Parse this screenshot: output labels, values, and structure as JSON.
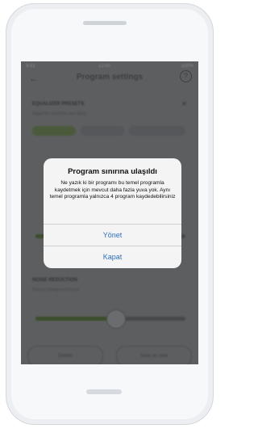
{
  "background_screen": {
    "status_left": "9:41",
    "status_center": "12:00",
    "status_right": "100%",
    "nav_title": "Program settings",
    "back_icon": "back-arrow-icon",
    "help_icon": "question-icon",
    "section1_title": "EQUALIZER PRESETS",
    "section1_sub": "Adjust the sound to your liking.",
    "section2_title": "NOISE REDUCTION",
    "section2_sub": "Reduce background noise.",
    "button_left": "Delete",
    "button_right": "Save as new",
    "colors": {
      "overlay": "#5c5e5f",
      "accent": "#3c4e2c"
    }
  },
  "dialog": {
    "title": "Program sınırına ulaşıldı",
    "message": "Ne yazık ki bir programı bu temel programla kaydetmek için mevcut daha fazla yuva yok. Aynı temel programla yalnızca 4 program kaydedebilirsiniz",
    "manage_label": "Yönet",
    "close_label": "Kapat",
    "colors": {
      "background": "#f4f4f5",
      "button_text": "#2e6fc6"
    }
  }
}
